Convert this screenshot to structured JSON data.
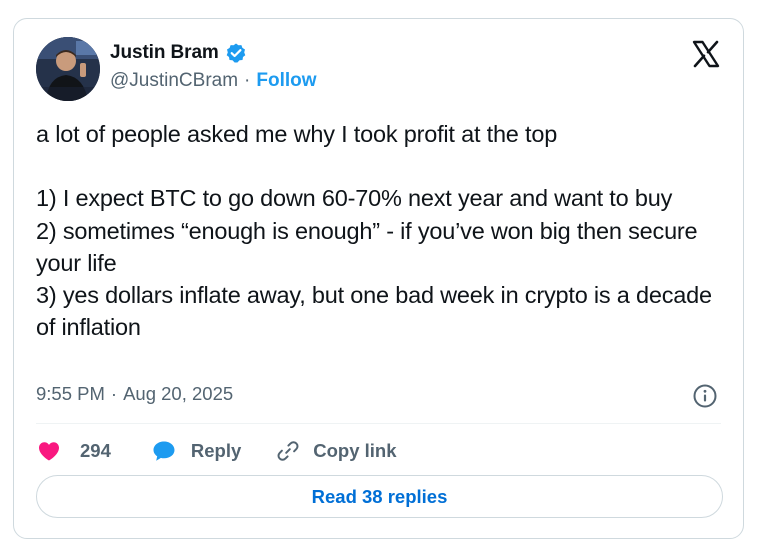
{
  "author": {
    "display_name": "Justin Bram",
    "handle": "@JustinCBram",
    "separator": "·",
    "follow_label": "Follow",
    "verified": true
  },
  "tweet": {
    "lines": [
      "a lot of people asked me why I took profit at the top",
      "",
      "1) I expect BTC to go down 60-70% next year and want to buy",
      "2) sometimes “enough is enough” - if you’ve won big then secure your life",
      "3) yes dollars inflate away, but one bad week in crypto is a decade of inflation"
    ],
    "time": "9:55 PM",
    "date_separator": "·",
    "date": "Aug 20, 2025"
  },
  "actions": {
    "like_count": "294",
    "reply_label": "Reply",
    "copy_link_label": "Copy link"
  },
  "read_replies_label": "Read 38 replies",
  "icons": {
    "verified": "verified-badge-icon",
    "brand": "x-logo-icon",
    "info": "info-icon",
    "like": "heart-icon",
    "reply": "speech-bubble-icon",
    "copy": "link-icon"
  },
  "colors": {
    "accent": "#1d9bf0",
    "like": "#f91880",
    "text": "#0f1419",
    "secondary": "#536471",
    "read_button_text": "#006fd6"
  }
}
